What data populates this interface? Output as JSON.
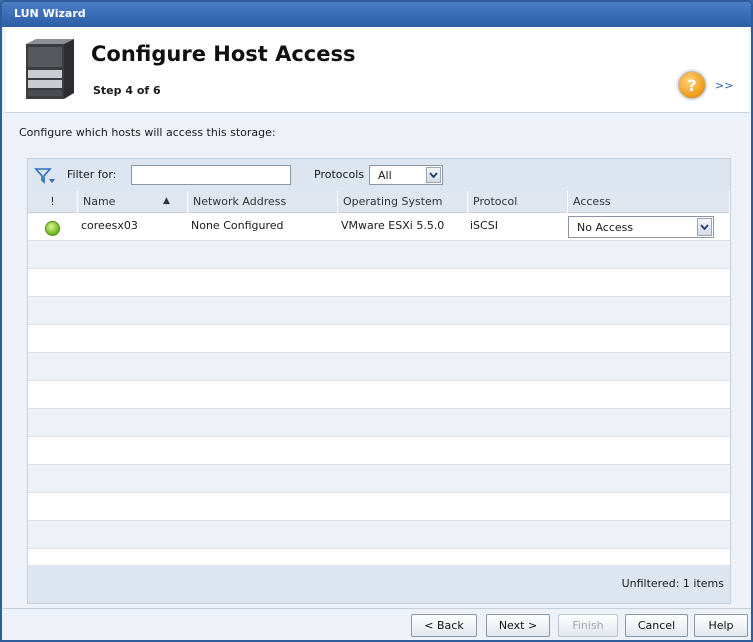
{
  "window": {
    "title": "LUN Wizard"
  },
  "header": {
    "title": "Configure Host Access",
    "step": "Step 4 of 6",
    "help_icon": "?",
    "expand_link": ">>"
  },
  "instructions": "Configure which hosts will access this storage:",
  "toolbar": {
    "filter_label": "Filter for:",
    "filter_value": "",
    "protocols_label": "Protocols",
    "protocols_selected": "All"
  },
  "table": {
    "columns": [
      "!",
      "Name",
      "Network Address",
      "Operating System",
      "Protocol",
      "Access"
    ],
    "sort_indicator": "▲",
    "rows": [
      {
        "status_icon": "ok-icon",
        "name": "coreesx03",
        "network_address": "None Configured",
        "os": "VMware ESXi 5.5.0",
        "protocol": "iSCSI",
        "access": "No Access"
      }
    ],
    "count": "Unfiltered: 1 items"
  },
  "buttons": {
    "back": "< Back",
    "next": "Next >",
    "finish": "Finish",
    "cancel": "Cancel",
    "help": "Help"
  }
}
